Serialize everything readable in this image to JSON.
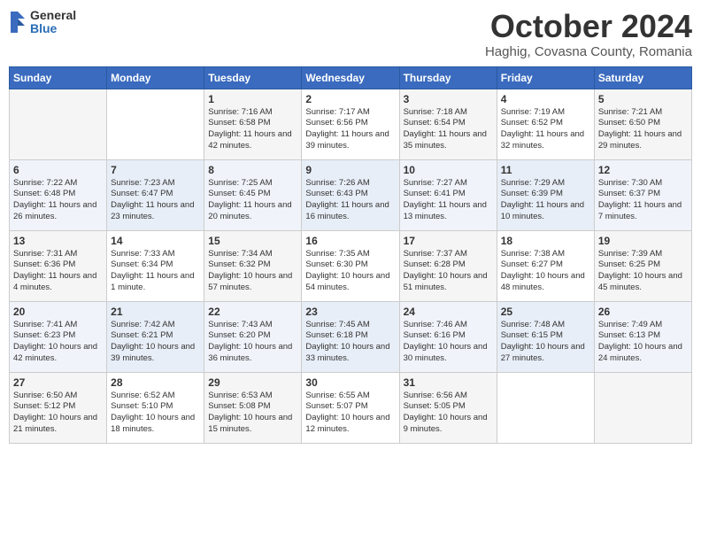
{
  "header": {
    "title": "October 2024",
    "location": "Haghig, Covasna County, Romania",
    "logo_general": "General",
    "logo_blue": "Blue"
  },
  "days_of_week": [
    "Sunday",
    "Monday",
    "Tuesday",
    "Wednesday",
    "Thursday",
    "Friday",
    "Saturday"
  ],
  "weeks": [
    [
      {
        "day": "",
        "info": ""
      },
      {
        "day": "",
        "info": ""
      },
      {
        "day": "1",
        "info": "Sunrise: 7:16 AM\nSunset: 6:58 PM\nDaylight: 11 hours and 42 minutes."
      },
      {
        "day": "2",
        "info": "Sunrise: 7:17 AM\nSunset: 6:56 PM\nDaylight: 11 hours and 39 minutes."
      },
      {
        "day": "3",
        "info": "Sunrise: 7:18 AM\nSunset: 6:54 PM\nDaylight: 11 hours and 35 minutes."
      },
      {
        "day": "4",
        "info": "Sunrise: 7:19 AM\nSunset: 6:52 PM\nDaylight: 11 hours and 32 minutes."
      },
      {
        "day": "5",
        "info": "Sunrise: 7:21 AM\nSunset: 6:50 PM\nDaylight: 11 hours and 29 minutes."
      }
    ],
    [
      {
        "day": "6",
        "info": "Sunrise: 7:22 AM\nSunset: 6:48 PM\nDaylight: 11 hours and 26 minutes."
      },
      {
        "day": "7",
        "info": "Sunrise: 7:23 AM\nSunset: 6:47 PM\nDaylight: 11 hours and 23 minutes."
      },
      {
        "day": "8",
        "info": "Sunrise: 7:25 AM\nSunset: 6:45 PM\nDaylight: 11 hours and 20 minutes."
      },
      {
        "day": "9",
        "info": "Sunrise: 7:26 AM\nSunset: 6:43 PM\nDaylight: 11 hours and 16 minutes."
      },
      {
        "day": "10",
        "info": "Sunrise: 7:27 AM\nSunset: 6:41 PM\nDaylight: 11 hours and 13 minutes."
      },
      {
        "day": "11",
        "info": "Sunrise: 7:29 AM\nSunset: 6:39 PM\nDaylight: 11 hours and 10 minutes."
      },
      {
        "day": "12",
        "info": "Sunrise: 7:30 AM\nSunset: 6:37 PM\nDaylight: 11 hours and 7 minutes."
      }
    ],
    [
      {
        "day": "13",
        "info": "Sunrise: 7:31 AM\nSunset: 6:36 PM\nDaylight: 11 hours and 4 minutes."
      },
      {
        "day": "14",
        "info": "Sunrise: 7:33 AM\nSunset: 6:34 PM\nDaylight: 11 hours and 1 minute."
      },
      {
        "day": "15",
        "info": "Sunrise: 7:34 AM\nSunset: 6:32 PM\nDaylight: 10 hours and 57 minutes."
      },
      {
        "day": "16",
        "info": "Sunrise: 7:35 AM\nSunset: 6:30 PM\nDaylight: 10 hours and 54 minutes."
      },
      {
        "day": "17",
        "info": "Sunrise: 7:37 AM\nSunset: 6:28 PM\nDaylight: 10 hours and 51 minutes."
      },
      {
        "day": "18",
        "info": "Sunrise: 7:38 AM\nSunset: 6:27 PM\nDaylight: 10 hours and 48 minutes."
      },
      {
        "day": "19",
        "info": "Sunrise: 7:39 AM\nSunset: 6:25 PM\nDaylight: 10 hours and 45 minutes."
      }
    ],
    [
      {
        "day": "20",
        "info": "Sunrise: 7:41 AM\nSunset: 6:23 PM\nDaylight: 10 hours and 42 minutes."
      },
      {
        "day": "21",
        "info": "Sunrise: 7:42 AM\nSunset: 6:21 PM\nDaylight: 10 hours and 39 minutes."
      },
      {
        "day": "22",
        "info": "Sunrise: 7:43 AM\nSunset: 6:20 PM\nDaylight: 10 hours and 36 minutes."
      },
      {
        "day": "23",
        "info": "Sunrise: 7:45 AM\nSunset: 6:18 PM\nDaylight: 10 hours and 33 minutes."
      },
      {
        "day": "24",
        "info": "Sunrise: 7:46 AM\nSunset: 6:16 PM\nDaylight: 10 hours and 30 minutes."
      },
      {
        "day": "25",
        "info": "Sunrise: 7:48 AM\nSunset: 6:15 PM\nDaylight: 10 hours and 27 minutes."
      },
      {
        "day": "26",
        "info": "Sunrise: 7:49 AM\nSunset: 6:13 PM\nDaylight: 10 hours and 24 minutes."
      }
    ],
    [
      {
        "day": "27",
        "info": "Sunrise: 6:50 AM\nSunset: 5:12 PM\nDaylight: 10 hours and 21 minutes."
      },
      {
        "day": "28",
        "info": "Sunrise: 6:52 AM\nSunset: 5:10 PM\nDaylight: 10 hours and 18 minutes."
      },
      {
        "day": "29",
        "info": "Sunrise: 6:53 AM\nSunset: 5:08 PM\nDaylight: 10 hours and 15 minutes."
      },
      {
        "day": "30",
        "info": "Sunrise: 6:55 AM\nSunset: 5:07 PM\nDaylight: 10 hours and 12 minutes."
      },
      {
        "day": "31",
        "info": "Sunrise: 6:56 AM\nSunset: 5:05 PM\nDaylight: 10 hours and 9 minutes."
      },
      {
        "day": "",
        "info": ""
      },
      {
        "day": "",
        "info": ""
      }
    ]
  ]
}
